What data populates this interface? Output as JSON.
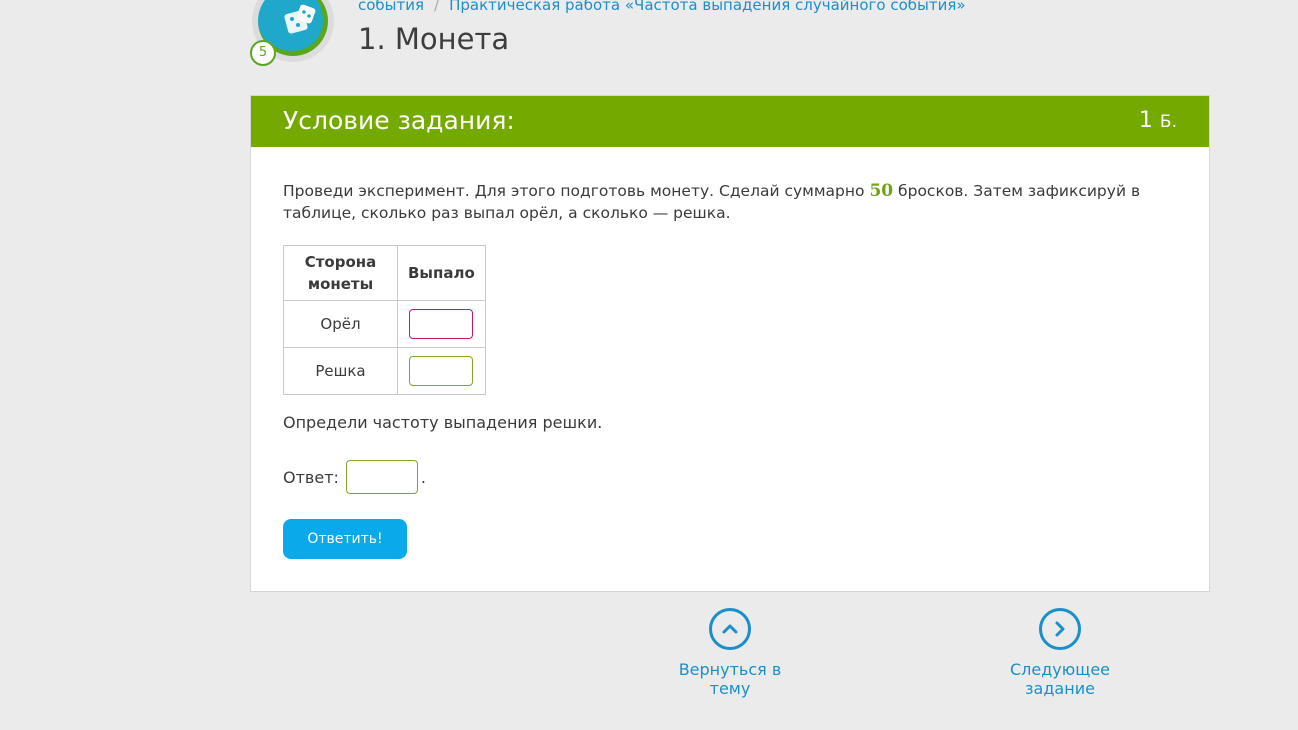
{
  "header": {
    "level": "5",
    "breadcrumb": [
      "события",
      "Практическая работа «Частота выпадения случайного события»"
    ],
    "separator": "/",
    "title": "1. Монета"
  },
  "task": {
    "heading": "Условие задания:",
    "points_value": "1",
    "points_unit": "Б.",
    "statement_before": "Проведи эксперимент. Для этого подготовь монету. Сделай суммарно ",
    "statement_number": "50",
    "statement_after": " бросков. Затем зафиксируй в таблице, сколько раз выпал орёл, а сколько — решка.",
    "table": {
      "headers": [
        "Сторона монеты",
        "Выпало"
      ],
      "rows": [
        {
          "side": "Орёл",
          "value": ""
        },
        {
          "side": "Решка",
          "value": ""
        }
      ]
    },
    "question": "Определи частоту выпадения решки.",
    "answer_label": "Ответ:",
    "answer_value": "",
    "answer_suffix": ".",
    "submit_label": "Ответить!"
  },
  "nav": {
    "back_label": "Вернуться в тему",
    "next_label": "Следующее задание"
  },
  "colors": {
    "accent_green": "#74aa00",
    "button_blue": "#0aaaea",
    "link_blue": "#1a8fc9",
    "active_input": "#c2186b"
  }
}
